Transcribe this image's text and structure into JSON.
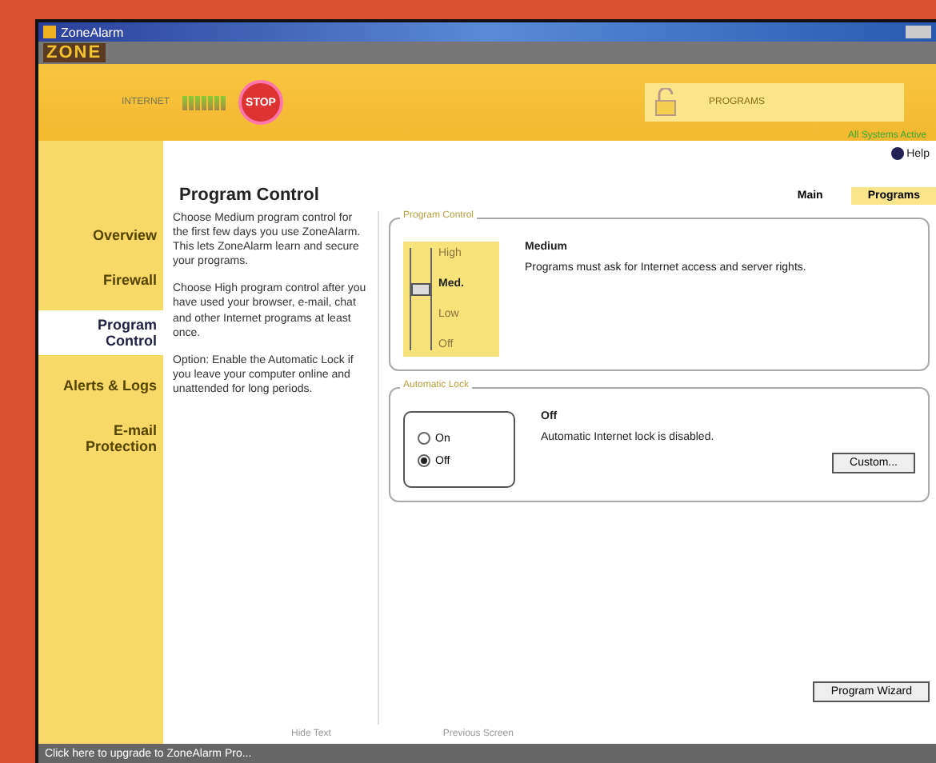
{
  "window": {
    "title": "ZoneAlarm"
  },
  "header": {
    "logo": "ZONE",
    "traffic_label": "INTERNET",
    "stop_label": "STOP",
    "programs_label": "PROGRAMS",
    "status": "All Systems Active",
    "help": "Help"
  },
  "sidebar": {
    "items": [
      {
        "label": "Overview",
        "selected": false
      },
      {
        "label": "Firewall",
        "selected": false
      },
      {
        "label": "Program Control",
        "selected": true
      },
      {
        "label": "Alerts & Logs",
        "selected": false
      },
      {
        "label": "E-mail Protection",
        "selected": false
      }
    ]
  },
  "page_title": "Program Control",
  "description": [
    "Choose Medium program control for the first few days you use ZoneAlarm. This lets ZoneAlarm learn and secure your programs.",
    "Choose High program control after you have used your browser, e-mail, chat and other Internet programs at least once.",
    "Option: Enable the Automatic Lock if you leave your computer online and unattended for long periods."
  ],
  "tabs": [
    {
      "label": "Main",
      "selected": true
    },
    {
      "label": "Programs",
      "selected": false
    }
  ],
  "program_control": {
    "legend": "Program Control",
    "levels": [
      {
        "label": "High",
        "selected": false
      },
      {
        "label": "Med.",
        "selected": true
      },
      {
        "label": "Low",
        "selected": false
      },
      {
        "label": "Off",
        "selected": false
      }
    ],
    "setting": "Medium",
    "info": "Programs must ask for Internet access and server rights."
  },
  "automatic_lock": {
    "legend": "Automatic Lock",
    "options": [
      {
        "label": "On",
        "selected": false
      },
      {
        "label": "Off",
        "selected": true
      }
    ],
    "setting": "Off",
    "info": "Automatic Internet lock is disabled.",
    "button": "Custom..."
  },
  "wizard_button": "Program Wizard",
  "footer_links": [
    "Hide Text",
    "Previous Screen"
  ],
  "status_bar": "Click here to upgrade to ZoneAlarm Pro..."
}
